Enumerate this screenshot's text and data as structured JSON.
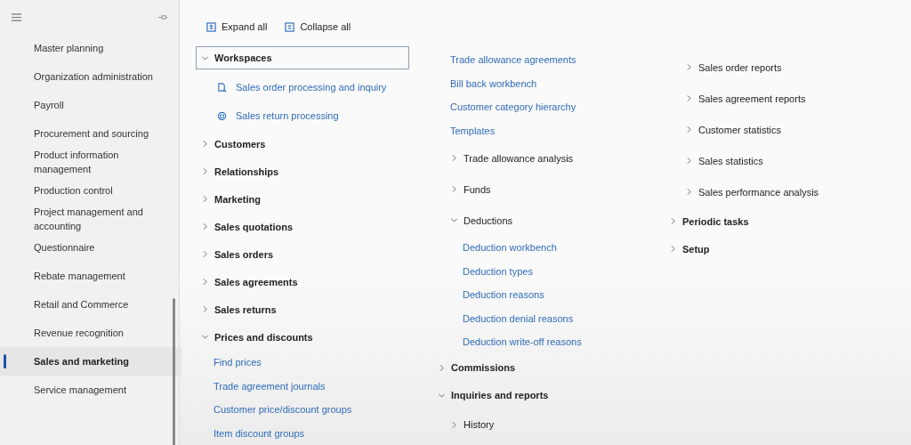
{
  "sidebar": {
    "items": [
      {
        "label": "Master planning",
        "selected": false
      },
      {
        "label": "Organization administration",
        "selected": false
      },
      {
        "label": "Payroll",
        "selected": false
      },
      {
        "label": "Procurement and sourcing",
        "selected": false
      },
      {
        "label": "Product information management",
        "selected": false
      },
      {
        "label": "Production control",
        "selected": false
      },
      {
        "label": "Project management and accounting",
        "selected": false
      },
      {
        "label": "Questionnaire",
        "selected": false
      },
      {
        "label": "Rebate management",
        "selected": false
      },
      {
        "label": "Retail and Commerce",
        "selected": false
      },
      {
        "label": "Revenue recognition",
        "selected": false
      },
      {
        "label": "Sales and marketing",
        "selected": true
      },
      {
        "label": "Service management",
        "selected": false
      }
    ]
  },
  "toolbar": {
    "buttons": [
      {
        "kind": "expand",
        "label": "Expand all"
      },
      {
        "kind": "collapse",
        "label": "Collapse all"
      }
    ]
  },
  "columns": [
    {
      "items": [
        {
          "kind": "group",
          "label": "Workspaces",
          "expanded": true,
          "selected": true,
          "children": [
            {
              "kind": "workspace",
              "label": "Sales order processing and inquiry",
              "selected": false
            },
            {
              "kind": "workspace",
              "label": "Sales return processing",
              "selected": false
            }
          ]
        },
        {
          "kind": "group",
          "label": "Customers",
          "expanded": false,
          "selected": false
        },
        {
          "kind": "group",
          "label": "Relationships",
          "expanded": false,
          "selected": false
        },
        {
          "kind": "group",
          "label": "Marketing",
          "expanded": false,
          "selected": false
        },
        {
          "kind": "group",
          "label": "Sales quotations",
          "expanded": false,
          "selected": false
        },
        {
          "kind": "group",
          "label": "Sales orders",
          "expanded": false,
          "selected": false
        },
        {
          "kind": "group",
          "label": "Sales agreements",
          "expanded": false,
          "selected": false
        },
        {
          "kind": "group",
          "label": "Sales returns",
          "expanded": false,
          "selected": false
        },
        {
          "kind": "group",
          "label": "Prices and discounts",
          "expanded": true,
          "selected": false,
          "children": [
            {
              "kind": "link",
              "label": "Find prices",
              "selected": false
            },
            {
              "kind": "link",
              "label": "Trade agreement journals",
              "selected": false
            },
            {
              "kind": "link",
              "label": "Customer price/discount groups",
              "selected": false
            },
            {
              "kind": "link",
              "label": "Item discount groups",
              "selected": false
            }
          ]
        }
      ]
    },
    {
      "items": [
        {
          "kind": "continued",
          "children": [
            {
              "kind": "link",
              "label": "Trade allowance agreements",
              "selected": false
            },
            {
              "kind": "link",
              "label": "Bill back workbench",
              "selected": false
            },
            {
              "kind": "link",
              "label": "Customer category hierarchy",
              "selected": false
            },
            {
              "kind": "link",
              "label": "Templates",
              "selected": false
            },
            {
              "kind": "subgroup",
              "label": "Trade allowance analysis",
              "expanded": false,
              "selected": false
            },
            {
              "kind": "subgroup",
              "label": "Funds",
              "expanded": false,
              "selected": false
            },
            {
              "kind": "subgroup",
              "label": "Deductions",
              "expanded": true,
              "selected": false,
              "children": [
                {
                  "kind": "link",
                  "label": "Deduction workbench",
                  "selected": false
                },
                {
                  "kind": "link",
                  "label": "Deduction types",
                  "selected": false
                },
                {
                  "kind": "link",
                  "label": "Deduction reasons",
                  "selected": false
                },
                {
                  "kind": "link",
                  "label": "Deduction denial reasons",
                  "selected": false
                },
                {
                  "kind": "link",
                  "label": "Deduction write-off reasons",
                  "selected": false
                }
              ]
            }
          ]
        },
        {
          "kind": "group",
          "label": "Commissions",
          "expanded": false,
          "selected": false
        },
        {
          "kind": "group",
          "label": "Inquiries and reports",
          "expanded": true,
          "selected": false,
          "children": [
            {
              "kind": "subgroup",
              "label": "History",
              "expanded": false,
              "selected": false
            }
          ]
        }
      ]
    },
    {
      "items": [
        {
          "kind": "continued",
          "children": [
            {
              "kind": "subgroup",
              "label": "Sales order reports",
              "expanded": false,
              "selected": false
            },
            {
              "kind": "subgroup",
              "label": "Sales agreement reports",
              "expanded": false,
              "selected": false
            },
            {
              "kind": "subgroup",
              "label": "Customer statistics",
              "expanded": false,
              "selected": false
            },
            {
              "kind": "subgroup",
              "label": "Sales statistics",
              "expanded": false,
              "selected": false
            },
            {
              "kind": "subgroup",
              "label": "Sales performance analysis",
              "expanded": false,
              "selected": false
            }
          ]
        },
        {
          "kind": "group",
          "label": "Periodic tasks",
          "expanded": false,
          "selected": false
        },
        {
          "kind": "group",
          "label": "Setup",
          "expanded": false,
          "selected": false
        }
      ]
    }
  ]
}
